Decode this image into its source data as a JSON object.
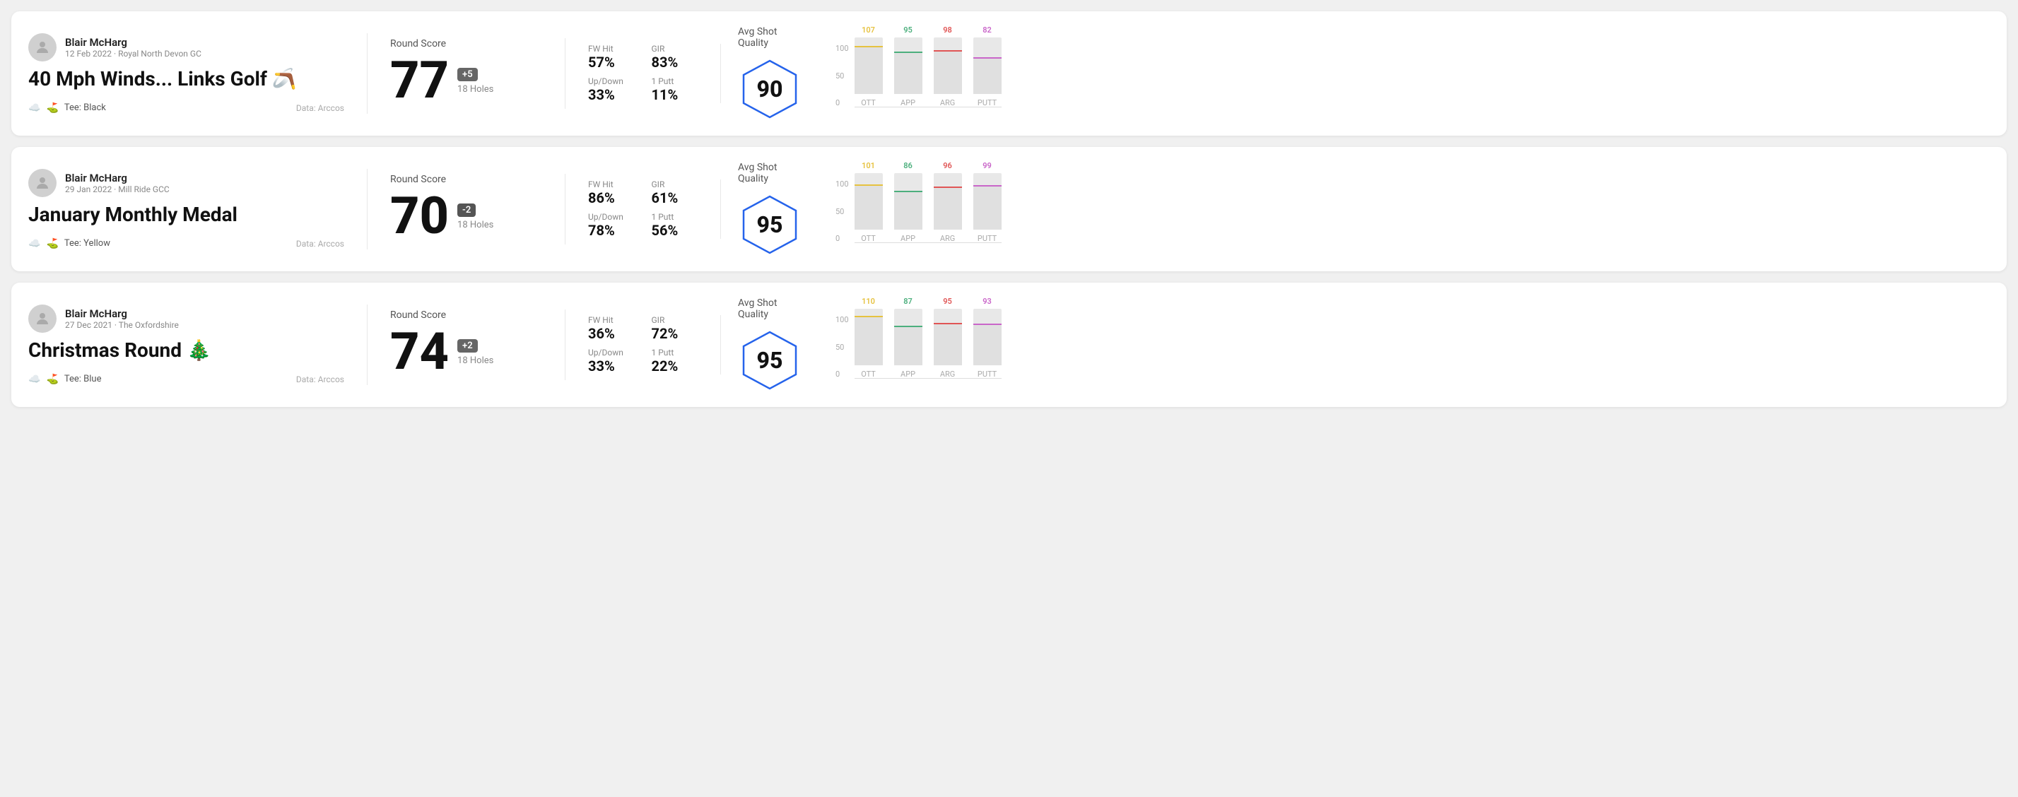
{
  "rounds": [
    {
      "id": "round1",
      "user": {
        "name": "Blair McHarg",
        "date": "12 Feb 2022",
        "course": "Royal North Devon GC"
      },
      "title": "40 Mph Winds... Links Golf 🪃",
      "tee": "Black",
      "data_source": "Data: Arccos",
      "score": "77",
      "score_diff": "+5",
      "score_diff_type": "over",
      "holes": "18 Holes",
      "stats": [
        {
          "label": "FW Hit",
          "value": "57%"
        },
        {
          "label": "GIR",
          "value": "83%"
        },
        {
          "label": "Up/Down",
          "value": "33%"
        },
        {
          "label": "1 Putt",
          "value": "11%"
        }
      ],
      "avg_shot_quality": "90",
      "chart": {
        "bars": [
          {
            "label": "OTT",
            "value": 107,
            "max": 120,
            "color": "#e6c240"
          },
          {
            "label": "APP",
            "value": 95,
            "max": 120,
            "color": "#4caf7d"
          },
          {
            "label": "ARG",
            "value": 98,
            "max": 120,
            "color": "#e05555"
          },
          {
            "label": "PUTT",
            "value": 82,
            "max": 120,
            "color": "#c966c9"
          }
        ]
      }
    },
    {
      "id": "round2",
      "user": {
        "name": "Blair McHarg",
        "date": "29 Jan 2022",
        "course": "Mill Ride GCC"
      },
      "title": "January Monthly Medal",
      "tee": "Yellow",
      "data_source": "Data: Arccos",
      "score": "70",
      "score_diff": "-2",
      "score_diff_type": "under",
      "holes": "18 Holes",
      "stats": [
        {
          "label": "FW Hit",
          "value": "86%"
        },
        {
          "label": "GIR",
          "value": "61%"
        },
        {
          "label": "Up/Down",
          "value": "78%"
        },
        {
          "label": "1 Putt",
          "value": "56%"
        }
      ],
      "avg_shot_quality": "95",
      "chart": {
        "bars": [
          {
            "label": "OTT",
            "value": 101,
            "max": 120,
            "color": "#e6c240"
          },
          {
            "label": "APP",
            "value": 86,
            "max": 120,
            "color": "#4caf7d"
          },
          {
            "label": "ARG",
            "value": 96,
            "max": 120,
            "color": "#e05555"
          },
          {
            "label": "PUTT",
            "value": 99,
            "max": 120,
            "color": "#c966c9"
          }
        ]
      }
    },
    {
      "id": "round3",
      "user": {
        "name": "Blair McHarg",
        "date": "27 Dec 2021",
        "course": "The Oxfordshire"
      },
      "title": "Christmas Round 🎄",
      "tee": "Blue",
      "data_source": "Data: Arccos",
      "score": "74",
      "score_diff": "+2",
      "score_diff_type": "over",
      "holes": "18 Holes",
      "stats": [
        {
          "label": "FW Hit",
          "value": "36%"
        },
        {
          "label": "GIR",
          "value": "72%"
        },
        {
          "label": "Up/Down",
          "value": "33%"
        },
        {
          "label": "1 Putt",
          "value": "22%"
        }
      ],
      "avg_shot_quality": "95",
      "chart": {
        "bars": [
          {
            "label": "OTT",
            "value": 110,
            "max": 120,
            "color": "#e6c240"
          },
          {
            "label": "APP",
            "value": 87,
            "max": 120,
            "color": "#4caf7d"
          },
          {
            "label": "ARG",
            "value": 95,
            "max": 120,
            "color": "#e05555"
          },
          {
            "label": "PUTT",
            "value": 93,
            "max": 120,
            "color": "#c966c9"
          }
        ]
      }
    }
  ],
  "labels": {
    "round_score": "Round Score",
    "avg_shot_quality": "Avg Shot Quality",
    "data_arccos": "Data: Arccos",
    "tee_prefix": "Tee: ",
    "y_axis_100": "100",
    "y_axis_50": "50",
    "y_axis_0": "0"
  }
}
